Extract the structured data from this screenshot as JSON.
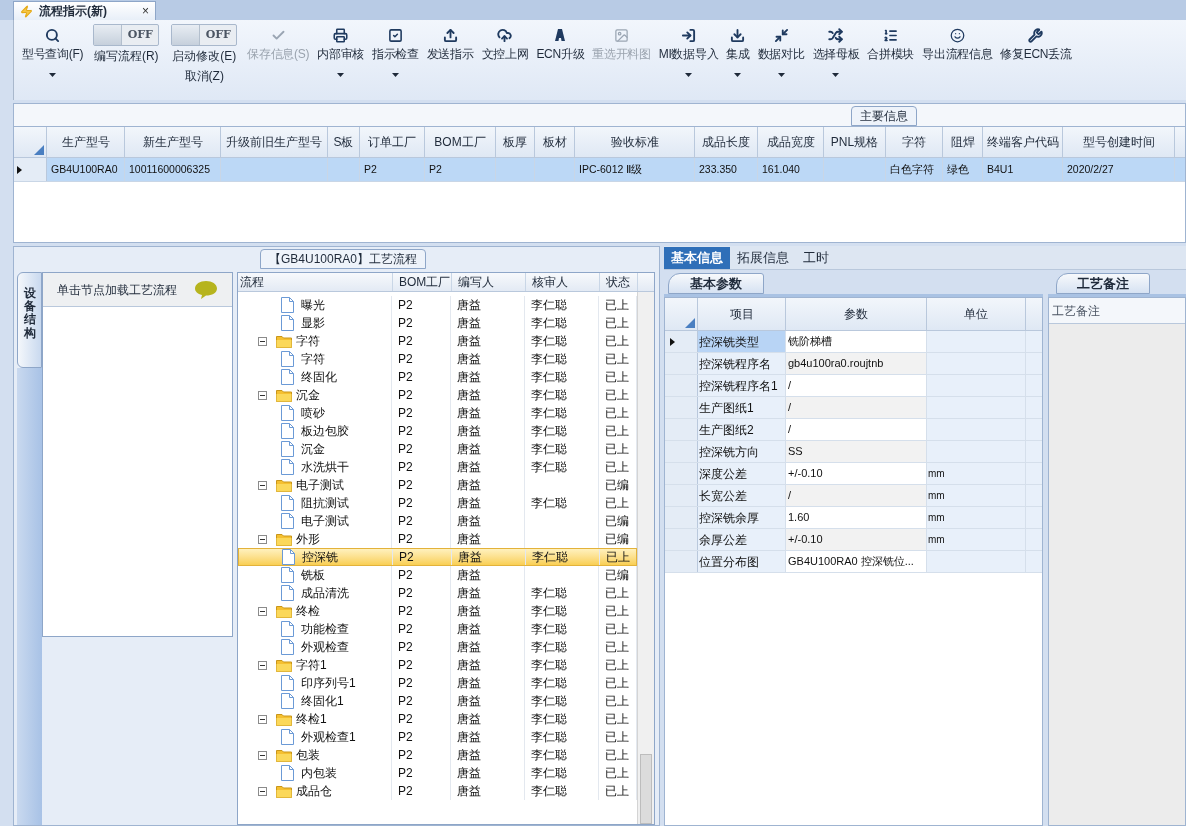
{
  "document_tab": {
    "title": "流程指示(新)",
    "close": "×"
  },
  "toolbar": [
    {
      "kind": "button",
      "label": [
        "型号查询(F)"
      ],
      "dropdown": true,
      "disabled": false
    },
    {
      "kind": "toggle",
      "switch_text": "OFF",
      "on": false,
      "label": [
        "编写流程(R)"
      ]
    },
    {
      "kind": "toggle",
      "switch_text": "OFF",
      "on": false,
      "label": [
        "启动修改(E)",
        "取消(Z)"
      ]
    },
    {
      "kind": "button",
      "label": [
        "保存信息(S)"
      ],
      "dropdown": false,
      "disabled": true
    },
    {
      "kind": "button",
      "label": [
        "内部审核"
      ],
      "dropdown": true,
      "disabled": false
    },
    {
      "kind": "button",
      "label": [
        "指示检查"
      ],
      "dropdown": true,
      "disabled": false
    },
    {
      "kind": "button",
      "label": [
        "发送指示"
      ],
      "dropdown": false,
      "disabled": false
    },
    {
      "kind": "button",
      "label": [
        "文控上网"
      ],
      "dropdown": false,
      "disabled": false
    },
    {
      "kind": "button",
      "label": [
        "ECN升级"
      ],
      "dropdown": false,
      "disabled": false
    },
    {
      "kind": "button",
      "label": [
        "重选开料图"
      ],
      "dropdown": false,
      "disabled": true
    },
    {
      "kind": "button",
      "label": [
        "MI数据导入"
      ],
      "dropdown": true,
      "disabled": false
    },
    {
      "kind": "button",
      "label": [
        "集成"
      ],
      "dropdown": true,
      "disabled": false
    },
    {
      "kind": "button",
      "label": [
        "数据对比"
      ],
      "dropdown": true,
      "disabled": false
    },
    {
      "kind": "button",
      "label": [
        "选择母板"
      ],
      "dropdown": true,
      "disabled": false
    },
    {
      "kind": "button",
      "label": [
        "合拼模块"
      ],
      "dropdown": false,
      "disabled": false
    },
    {
      "kind": "button",
      "label": [
        "导出流程信息"
      ],
      "dropdown": false,
      "disabled": false
    },
    {
      "kind": "button",
      "label": [
        "修复ECN丢流"
      ],
      "dropdown": false,
      "disabled": false
    }
  ],
  "main_info": {
    "title": "主要信息",
    "columns": [
      "生产型号",
      "新生产型号",
      "升级前旧生产型号",
      "S板",
      "订单工厂",
      "BOM工厂",
      "板厚",
      "板材",
      "验收标准",
      "成品长度",
      "成品宽度",
      "PNL规格",
      "字符",
      "阻焊",
      "终端客户代码",
      "型号创建时间"
    ],
    "rows": [
      {
        "selected": true,
        "cells": [
          "GB4U100RA0",
          "10011600006325",
          null,
          null,
          "P2",
          "P2",
          null,
          null,
          "IPC-6012 Ⅱ级",
          "233.350",
          "161.040",
          null,
          "白色字符",
          "绿色",
          "B4U1",
          "2020/2/27"
        ]
      }
    ]
  },
  "process_panel": {
    "title": "【GB4U100RA0】工艺流程",
    "side_tab": "设备结构",
    "list_header": "单击节点加载工艺流程",
    "columns": [
      "流程",
      "BOM工厂",
      "编写人",
      "核审人",
      "状态"
    ],
    "nodes": [
      {
        "children": [
          {
            "name": "曝光",
            "bom": "P2",
            "writer": "唐益",
            "reviewer": "李仁聪",
            "status": "已上",
            "selected": false
          },
          {
            "name": "显影",
            "bom": "P2",
            "writer": "唐益",
            "reviewer": "李仁聪",
            "status": "已上",
            "selected": false
          }
        ]
      },
      {
        "name": "字符",
        "bom": "P2",
        "writer": "唐益",
        "reviewer": "李仁聪",
        "status": "已上",
        "selected": false,
        "expanded": true,
        "children": [
          {
            "name": "字符",
            "bom": "P2",
            "writer": "唐益",
            "reviewer": "李仁聪",
            "status": "已上",
            "selected": false
          },
          {
            "name": "终固化",
            "bom": "P2",
            "writer": "唐益",
            "reviewer": "李仁聪",
            "status": "已上",
            "selected": false
          }
        ]
      },
      {
        "name": "沉金",
        "bom": "P2",
        "writer": "唐益",
        "reviewer": "李仁聪",
        "status": "已上",
        "selected": false,
        "expanded": true,
        "children": [
          {
            "name": "喷砂",
            "bom": "P2",
            "writer": "唐益",
            "reviewer": "李仁聪",
            "status": "已上",
            "selected": false
          },
          {
            "name": "板边包胶",
            "bom": "P2",
            "writer": "唐益",
            "reviewer": "李仁聪",
            "status": "已上",
            "selected": false
          },
          {
            "name": "沉金",
            "bom": "P2",
            "writer": "唐益",
            "reviewer": "李仁聪",
            "status": "已上",
            "selected": false
          },
          {
            "name": "水洗烘干",
            "bom": "P2",
            "writer": "唐益",
            "reviewer": "李仁聪",
            "status": "已上",
            "selected": false
          }
        ]
      },
      {
        "name": "电子测试",
        "bom": "P2",
        "writer": "唐益",
        "status": "已编",
        "selected": false,
        "expanded": true,
        "children": [
          {
            "name": "阻抗测试",
            "bom": "P2",
            "writer": "唐益",
            "reviewer": "李仁聪",
            "status": "已上",
            "selected": false
          },
          {
            "name": "电子测试",
            "bom": "P2",
            "writer": "唐益",
            "status": "已编",
            "selected": false
          }
        ]
      },
      {
        "name": "外形",
        "bom": "P2",
        "writer": "唐益",
        "status": "已编",
        "selected": false,
        "expanded": true,
        "children": [
          {
            "name": "控深铣",
            "bom": "P2",
            "writer": "唐益",
            "reviewer": "李仁聪",
            "status": "已上",
            "selected": true
          },
          {
            "name": "铣板",
            "bom": "P2",
            "writer": "唐益",
            "status": "已编",
            "selected": false
          },
          {
            "name": "成品清洗",
            "bom": "P2",
            "writer": "唐益",
            "reviewer": "李仁聪",
            "status": "已上",
            "selected": false
          }
        ]
      },
      {
        "name": "终检",
        "bom": "P2",
        "writer": "唐益",
        "reviewer": "李仁聪",
        "status": "已上",
        "selected": false,
        "expanded": true,
        "children": [
          {
            "name": "功能检查",
            "bom": "P2",
            "writer": "唐益",
            "reviewer": "李仁聪",
            "status": "已上",
            "selected": false
          },
          {
            "name": "外观检查",
            "bom": "P2",
            "writer": "唐益",
            "reviewer": "李仁聪",
            "status": "已上",
            "selected": false
          }
        ]
      },
      {
        "name": "字符1",
        "bom": "P2",
        "writer": "唐益",
        "reviewer": "李仁聪",
        "status": "已上",
        "selected": false,
        "expanded": true,
        "children": [
          {
            "name": "印序列号1",
            "bom": "P2",
            "writer": "唐益",
            "reviewer": "李仁聪",
            "status": "已上",
            "selected": false
          },
          {
            "name": "终固化1",
            "bom": "P2",
            "writer": "唐益",
            "reviewer": "李仁聪",
            "status": "已上",
            "selected": false
          }
        ]
      },
      {
        "name": "终检1",
        "bom": "P2",
        "writer": "唐益",
        "reviewer": "李仁聪",
        "status": "已上",
        "selected": false,
        "expanded": true,
        "children": [
          {
            "name": "外观检查1",
            "bom": "P2",
            "writer": "唐益",
            "reviewer": "李仁聪",
            "status": "已上",
            "selected": false
          }
        ]
      },
      {
        "name": "包装",
        "bom": "P2",
        "writer": "唐益",
        "reviewer": "李仁聪",
        "status": "已上",
        "selected": false,
        "expanded": true,
        "children": [
          {
            "name": "内包装",
            "bom": "P2",
            "writer": "唐益",
            "reviewer": "李仁聪",
            "status": "已上",
            "selected": false
          }
        ]
      },
      {
        "name": "成品仓",
        "bom": "P2",
        "writer": "唐益",
        "reviewer": "李仁聪",
        "status": "已上",
        "selected": false,
        "expanded": true
      }
    ]
  },
  "detail_tabs": [
    {
      "label": "基本信息",
      "selected": true
    },
    {
      "label": "拓展信息",
      "selected": false
    },
    {
      "label": "工时",
      "selected": false
    }
  ],
  "params": {
    "tab": "基本参数",
    "columns": [
      "项目",
      "参数",
      "单位"
    ],
    "rows": [
      {
        "item": "控深铣类型",
        "value": "铣阶梯槽",
        "selected": true
      },
      {
        "item": "控深铣程序名",
        "value": "gb4u100ra0.roujtnb",
        "selected": false
      },
      {
        "item": "控深铣程序名1",
        "value": "/",
        "selected": false
      },
      {
        "item": "生产图纸1",
        "value": "/",
        "selected": false
      },
      {
        "item": "生产图纸2",
        "value": "/",
        "selected": false
      },
      {
        "item": "控深铣方向",
        "value": "SS",
        "selected": false
      },
      {
        "item": "深度公差",
        "value": "+/-0.10",
        "unit": "mm",
        "selected": false
      },
      {
        "item": "长宽公差",
        "value": "/",
        "unit": "mm",
        "selected": false
      },
      {
        "item": "控深铣余厚",
        "value": "1.60",
        "unit": "mm",
        "selected": false
      },
      {
        "item": "余厚公差",
        "value": "+/-0.10",
        "unit": "mm",
        "selected": false
      },
      {
        "item": "位置分布图",
        "value": "GB4U100RA0 控深铣位...",
        "selected": false
      }
    ]
  },
  "notes": {
    "tab": "工艺备注",
    "header": "工艺备注"
  }
}
